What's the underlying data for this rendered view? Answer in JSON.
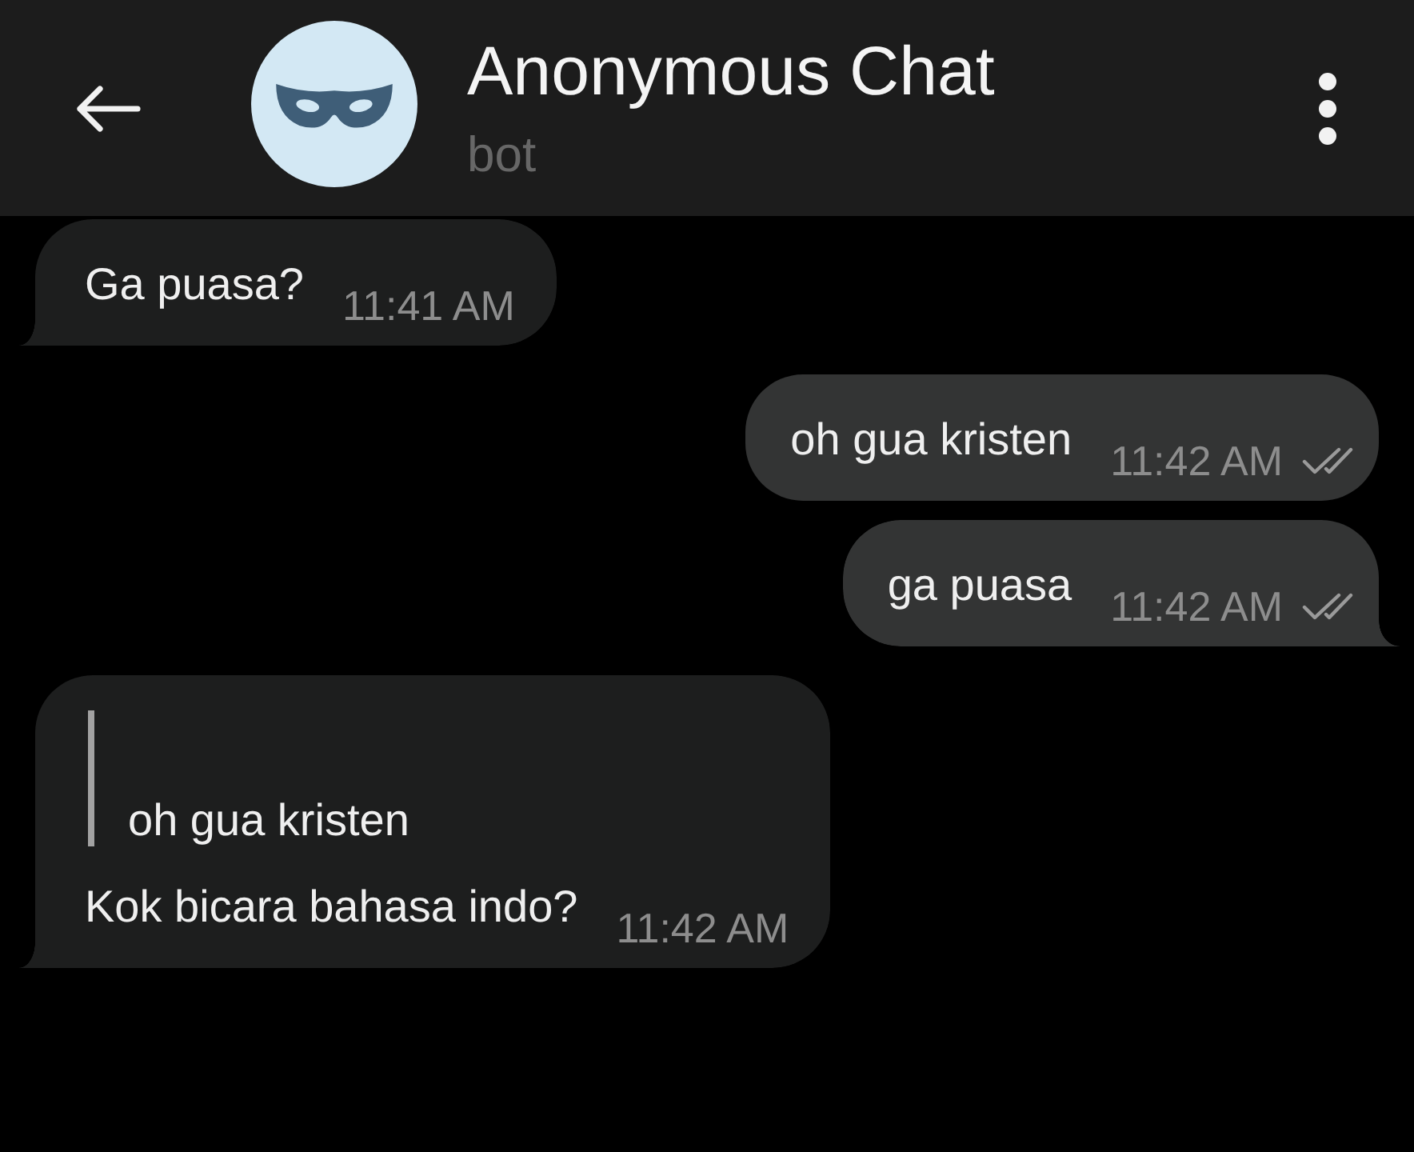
{
  "header": {
    "title": "Anonymous Chat",
    "subtitle": "bot"
  },
  "messages": [
    {
      "kind": "incoming",
      "text": "Ga puasa?",
      "time": "11:41 AM"
    },
    {
      "kind": "outgoing",
      "text": "oh gua kristen",
      "time": "11:42 AM",
      "read": true
    },
    {
      "kind": "outgoing",
      "text": "ga puasa",
      "time": "11:42 AM",
      "read": true
    },
    {
      "kind": "incoming",
      "reply": {
        "text": "oh gua kristen"
      },
      "text": "Kok bicara bahasa indo?",
      "time": "11:42 AM"
    }
  ]
}
